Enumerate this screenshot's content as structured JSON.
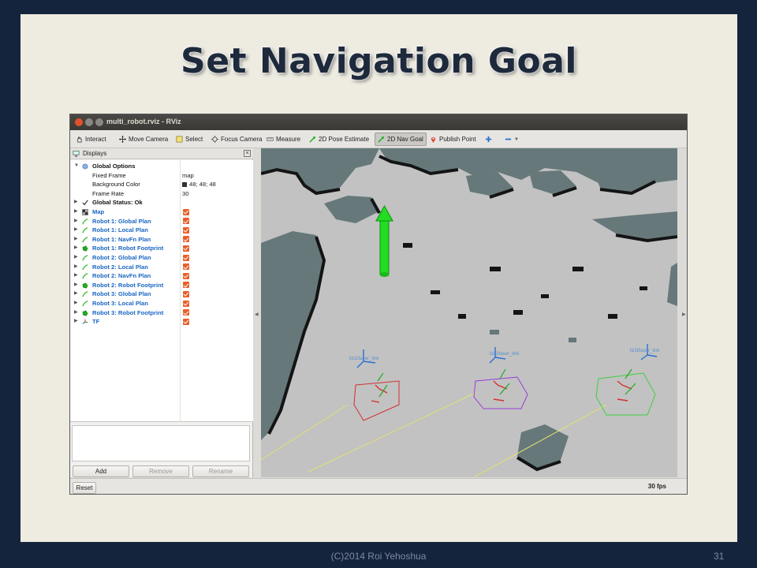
{
  "slide": {
    "title": "Set Navigation Goal",
    "footer": "(C)2014 Roi Yehoshua",
    "page_number": "31"
  },
  "window": {
    "title": "multi_robot.rviz - RViz"
  },
  "toolbar": {
    "tools": [
      {
        "label": "Interact",
        "icon": "hand-icon"
      },
      {
        "label": "Move Camera",
        "icon": "move-camera-icon"
      },
      {
        "label": "Select",
        "icon": "select-icon"
      },
      {
        "label": "Focus Camera",
        "icon": "focus-camera-icon"
      },
      {
        "label": "Measure",
        "icon": "measure-icon"
      },
      {
        "label": "2D Pose Estimate",
        "icon": "pose-estimate-icon"
      },
      {
        "label": "2D Nav Goal",
        "icon": "nav-goal-icon",
        "active": true
      },
      {
        "label": "Publish Point",
        "icon": "publish-point-icon"
      }
    ]
  },
  "displays": {
    "title": "Displays",
    "rows": [
      {
        "label": "Global Options",
        "icon": "globe-icon"
      },
      {
        "label": "Fixed Frame",
        "value": "map"
      },
      {
        "label": "Background Color",
        "value": "48; 48; 48"
      },
      {
        "label": "Frame Rate",
        "value": "30"
      },
      {
        "label": "Global Status: Ok",
        "icon": "check-icon"
      },
      {
        "label": "Map",
        "icon": "map-icon",
        "checked": true
      },
      {
        "label": "Robot 1: Global Plan",
        "icon": "path-icon",
        "checked": true
      },
      {
        "label": "Robot 1: Local Plan",
        "icon": "path-icon",
        "checked": true
      },
      {
        "label": "Robot 1: NavFn Plan",
        "icon": "path-icon",
        "checked": true
      },
      {
        "label": "Robot 1: Robot Footprint",
        "icon": "polygon-icon",
        "checked": true
      },
      {
        "label": "Robot 2: Global Plan",
        "icon": "path-icon",
        "checked": true
      },
      {
        "label": "Robot 2: Local Plan",
        "icon": "path-icon",
        "checked": true
      },
      {
        "label": "Robot 2: NavFn Plan",
        "icon": "path-icon",
        "checked": true
      },
      {
        "label": "Robot 2: Robot Footprint",
        "icon": "polygon-icon",
        "checked": true
      },
      {
        "label": "Robot 3: Global Plan",
        "icon": "path-icon",
        "checked": true
      },
      {
        "label": "Robot 3: Local Plan",
        "icon": "path-icon",
        "checked": true
      },
      {
        "label": "Robot 3: Robot Footprint",
        "icon": "polygon-icon",
        "checked": true
      },
      {
        "label": "TF",
        "icon": "tf-icon",
        "checked": true
      }
    ],
    "buttons": {
      "add": "Add",
      "remove": "Remove",
      "rename": "Rename"
    }
  },
  "statusbar": {
    "reset": "Reset",
    "fps": "30 fps"
  },
  "viewport": {
    "frame_labels": [
      "lizi1/laser_link",
      "lizi2/laser_link",
      "lizi3/laser_link"
    ]
  },
  "colors": {
    "slide_bg": "#eeebe1",
    "frame_bg": "#14243c",
    "map_free": "#c2c2c2",
    "map_occupied": "#66787a",
    "map_edge": "#141414",
    "nav_goal_arrow": "#22dd22",
    "robot1_footprint": "#d23030",
    "robot2_footprint": "#9a3cd8",
    "robot3_footprint": "#3ccf3c"
  }
}
